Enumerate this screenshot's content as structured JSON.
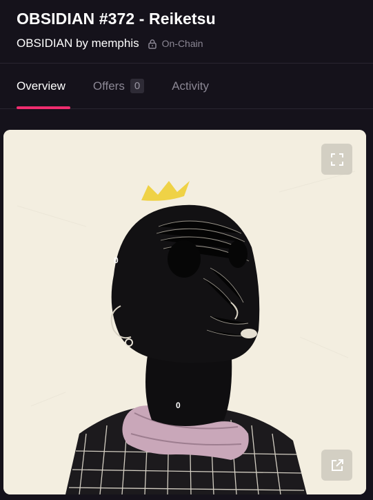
{
  "header": {
    "title": "OBSIDIAN #372 - Reiketsu",
    "collection": "OBSIDIAN by memphis",
    "onchain_label": "On-Chain"
  },
  "tabs": [
    {
      "label": "Overview",
      "active": true
    },
    {
      "label": "Offers",
      "badge": "0",
      "active": false
    },
    {
      "label": "Activity",
      "active": false
    }
  ],
  "artwork": {
    "description_icon": "portrait-artwork",
    "expand_icon": "expand-icon",
    "external_icon": "external-link-icon"
  },
  "colors": {
    "background": "#15121b",
    "accent": "#ef2d6f",
    "muted": "#8b8794",
    "canvas": "#f3eee0"
  }
}
